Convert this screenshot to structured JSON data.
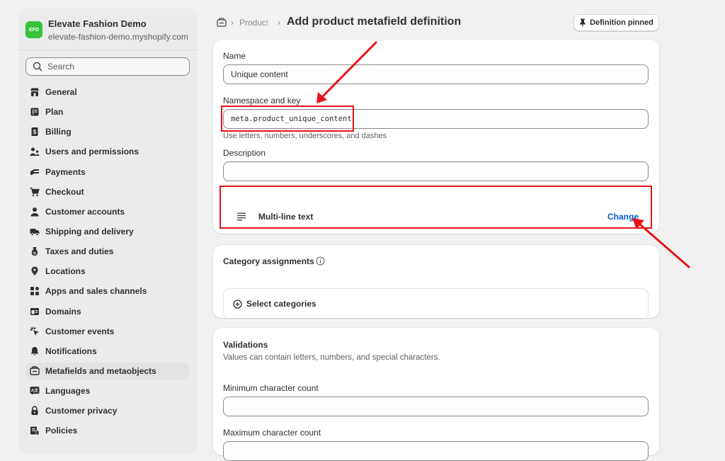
{
  "store": {
    "logo_text": "EFD",
    "name": "Elevate Fashion Demo",
    "url": "elevate-fashion-demo.myshopify.com"
  },
  "search": {
    "placeholder": "Search"
  },
  "nav": [
    {
      "label": "General",
      "icon": "store-icon"
    },
    {
      "label": "Plan",
      "icon": "plan-icon"
    },
    {
      "label": "Billing",
      "icon": "billing-icon"
    },
    {
      "label": "Users and permissions",
      "icon": "users-icon"
    },
    {
      "label": "Payments",
      "icon": "payments-icon"
    },
    {
      "label": "Checkout",
      "icon": "cart-icon"
    },
    {
      "label": "Customer accounts",
      "icon": "person-icon"
    },
    {
      "label": "Shipping and delivery",
      "icon": "truck-icon"
    },
    {
      "label": "Taxes and duties",
      "icon": "tax-icon"
    },
    {
      "label": "Locations",
      "icon": "location-icon"
    },
    {
      "label": "Apps and sales channels",
      "icon": "apps-icon"
    },
    {
      "label": "Domains",
      "icon": "globe-icon"
    },
    {
      "label": "Customer events",
      "icon": "events-icon"
    },
    {
      "label": "Notifications",
      "icon": "bell-icon"
    },
    {
      "label": "Metafields and metaobjects",
      "icon": "metafields-icon",
      "active": true
    },
    {
      "label": "Languages",
      "icon": "language-icon"
    },
    {
      "label": "Customer privacy",
      "icon": "lock-icon"
    },
    {
      "label": "Policies",
      "icon": "policies-icon"
    }
  ],
  "header": {
    "breadcrumb_product": "Product",
    "separator": "›",
    "title": "Add product metafield definition",
    "pin_button": "Definition pinned"
  },
  "definition": {
    "name_label": "Name",
    "name_value": "Unique content",
    "namespace_label": "Namespace and key",
    "namespace_value": "meta.product_unique_content",
    "namespace_help": "Use letters, numbers, underscores, and dashes",
    "description_label": "Description",
    "description_value": "",
    "type_name": "Multi-line text",
    "change_label": "Change"
  },
  "categories": {
    "title": "Category assignments",
    "select_label": "Select categories"
  },
  "validations": {
    "title": "Validations",
    "subtitle": "Values can contain letters, numbers, and special characters.",
    "min_label": "Minimum character count",
    "min_value": "",
    "max_label": "Maximum character count"
  },
  "colors": {
    "annotation": "#e8141b",
    "link": "#005bd3",
    "store_logo": "#36c43a"
  }
}
